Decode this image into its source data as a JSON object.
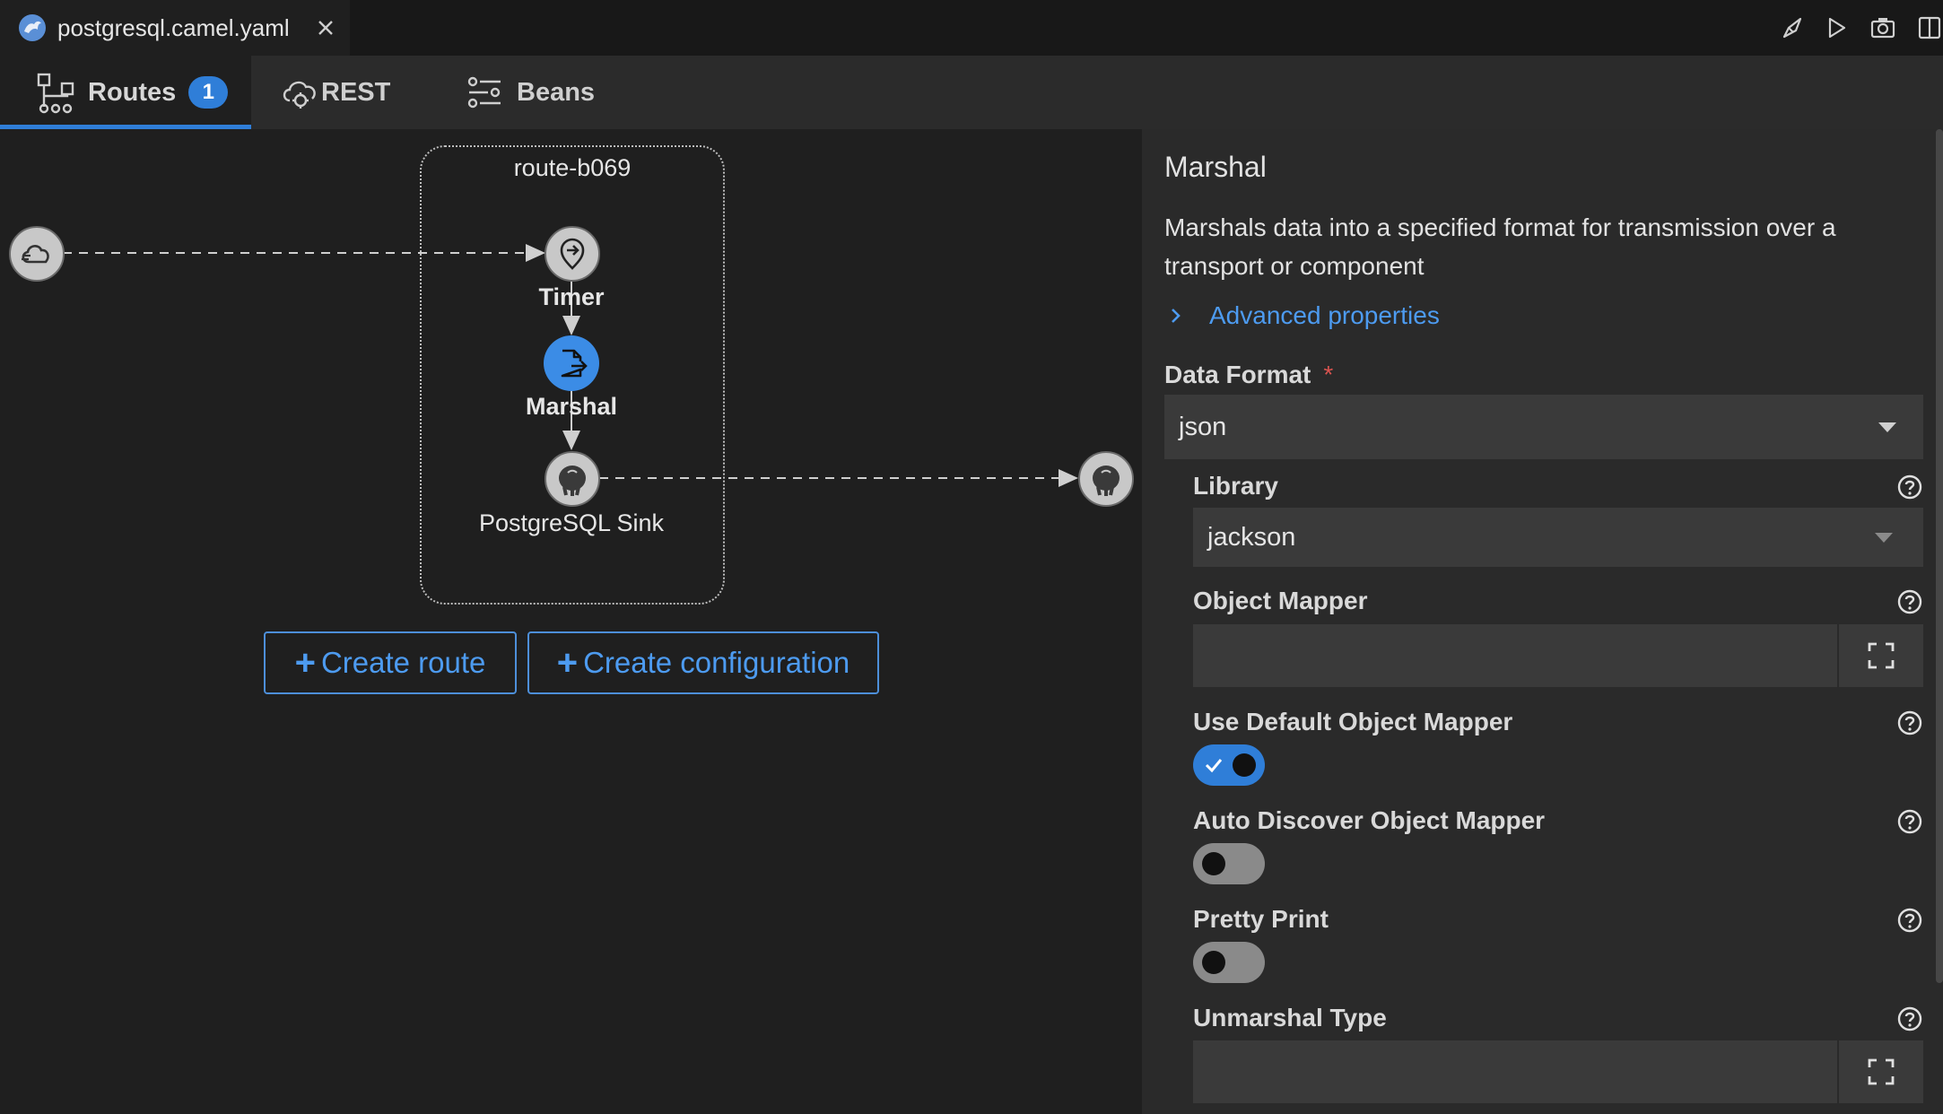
{
  "file_tab": {
    "name": "postgresql.camel.yaml"
  },
  "title_actions": [
    "rocket-icon",
    "run-icon",
    "camera-icon",
    "split-editor-icon",
    "more-icon"
  ],
  "tabs": [
    {
      "label": "Routes",
      "badge": "1",
      "icon": "routes-icon",
      "active": true
    },
    {
      "label": "REST",
      "icon": "rest-cloud-icon"
    },
    {
      "label": "Beans",
      "icon": "beans-icon"
    }
  ],
  "canvas": {
    "route_title": "route-b069",
    "nodes": {
      "timer": "Timer",
      "marshal": "Marshal",
      "sink": "PostgreSQL Sink"
    },
    "create_route": "Create route",
    "create_configuration": "Create configuration"
  },
  "panel": {
    "title": "Marshal",
    "description": "Marshals data into a specified format for transmission over a transport or component",
    "advanced": "Advanced properties",
    "data_format_label": "Data Format",
    "data_format_required": "*",
    "data_format_value": "json",
    "library_label": "Library",
    "library_value": "jackson",
    "object_mapper_label": "Object Mapper",
    "object_mapper_value": "",
    "use_default_label": "Use Default Object Mapper",
    "use_default_on": true,
    "auto_discover_label": "Auto Discover Object Mapper",
    "auto_discover_on": false,
    "pretty_print_label": "Pretty Print",
    "pretty_print_on": false,
    "unmarshal_type_label": "Unmarshal Type",
    "unmarshal_type_value": ""
  },
  "colors": {
    "accent": "#2f7ed8",
    "link": "#4d9bf0",
    "panel_bg": "#2a2a2a",
    "canvas_bg": "#1f1f1f"
  }
}
